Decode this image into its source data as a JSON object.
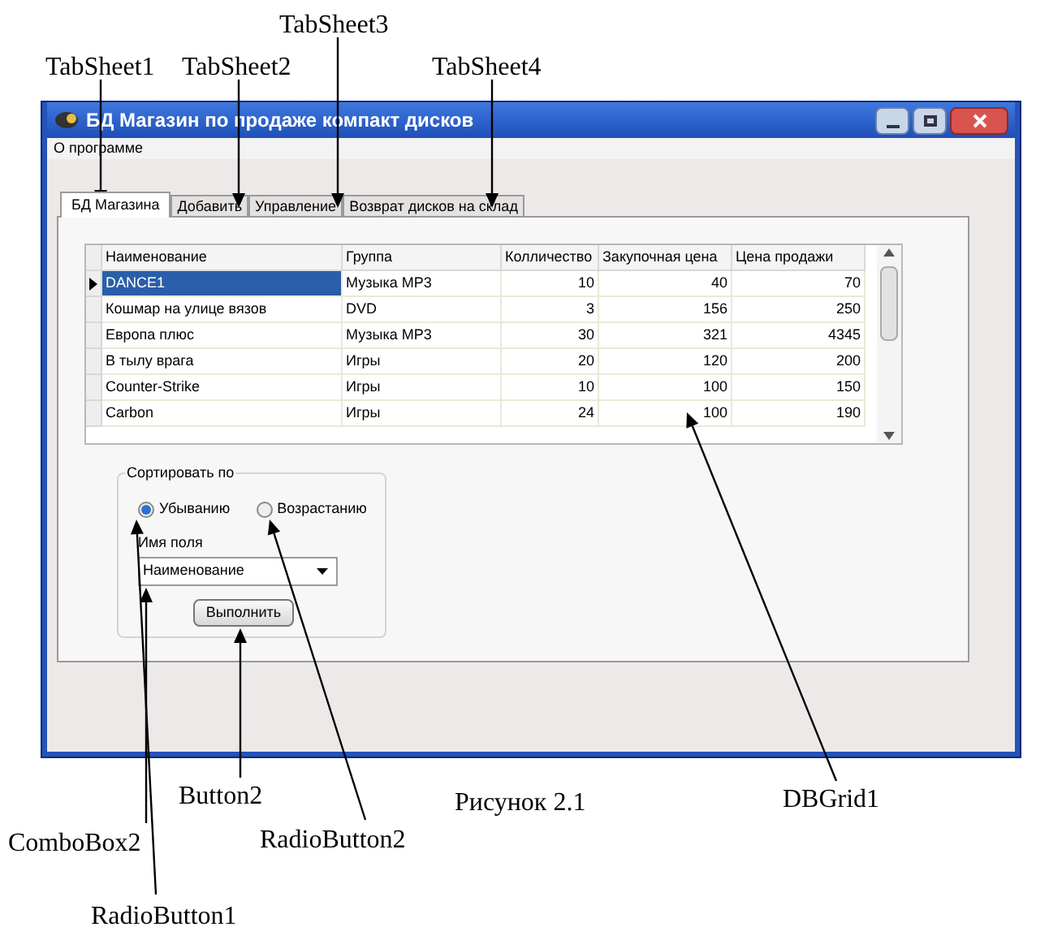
{
  "annotations": [
    {
      "text": "TabSheet3"
    },
    {
      "text": "TabSheet1"
    },
    {
      "text": "TabSheet2"
    },
    {
      "text": "TabSheet4"
    },
    {
      "text": "Button2"
    },
    {
      "text": "DBGrid1"
    },
    {
      "text": "ComboBox2"
    },
    {
      "text": "RadioButton2"
    },
    {
      "text": "RadioButton1"
    }
  ],
  "caption": "Рисунок 2.1",
  "window": {
    "title": "БД Магазин по продаже компакт дисков",
    "menu": [
      "О программе"
    ],
    "tabs": [
      {
        "label": "БД Магазина",
        "selected": true
      },
      {
        "label": "Добавить",
        "selected": false
      },
      {
        "label": "Управление",
        "selected": false
      },
      {
        "label": "Возврат дисков на склад",
        "selected": false
      }
    ],
    "grid": {
      "columns": [
        "Наименование",
        "Группа",
        "Колличество",
        "Закупочная цена",
        "Цена продажи"
      ],
      "rows": [
        {
          "cells": [
            "DANCE1",
            "Музыка MP3",
            "10",
            "40",
            "70"
          ],
          "selected": true
        },
        {
          "cells": [
            "Кошмар на улице вязов",
            "DVD",
            "3",
            "156",
            "250"
          ],
          "selected": false
        },
        {
          "cells": [
            "Европа плюс",
            "Музыка MP3",
            "30",
            "321",
            "4345"
          ],
          "selected": false
        },
        {
          "cells": [
            "В тылу врага",
            "Игры",
            "20",
            "120",
            "200"
          ],
          "selected": false
        },
        {
          "cells": [
            "Counter-Strike",
            "Игры",
            "10",
            "100",
            "150"
          ],
          "selected": false
        },
        {
          "cells": [
            "Carbon",
            "Игры",
            "24",
            "100",
            "190"
          ],
          "selected": false
        }
      ]
    },
    "sort_group": {
      "title": "Сортировать по",
      "radios": [
        {
          "label": "Убыванию",
          "selected": true
        },
        {
          "label": "Возрастанию",
          "selected": false
        }
      ],
      "field_label": "Имя поля",
      "combo": {
        "value": "Наименование"
      },
      "button": "Выполнить"
    }
  }
}
